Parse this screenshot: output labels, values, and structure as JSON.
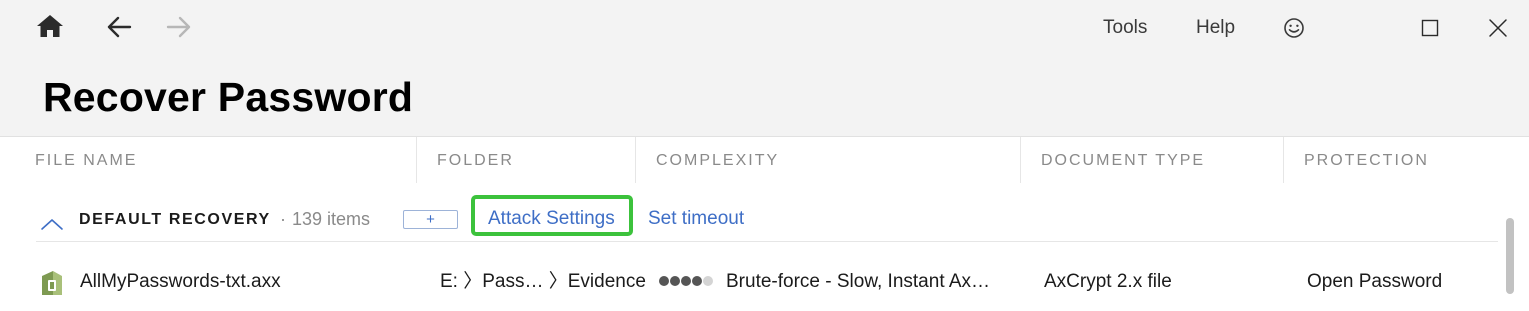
{
  "titlebar": {
    "home_icon": "home-icon",
    "back_icon": "arrow-left-icon",
    "forward_icon": "arrow-right-icon",
    "menu": [
      {
        "label": "Tools"
      },
      {
        "label": "Help"
      }
    ],
    "feedback_icon": "smiley-icon",
    "maximize_icon": "maximize-icon",
    "close_icon": "close-icon"
  },
  "page": {
    "title": "Recover Password"
  },
  "columns": [
    {
      "label": "FILE NAME"
    },
    {
      "label": "FOLDER"
    },
    {
      "label": "COMPLEXITY"
    },
    {
      "label": "DOCUMENT TYPE"
    },
    {
      "label": "PROTECTION"
    }
  ],
  "group": {
    "title": "DEFAULT RECOVERY",
    "separator": "·",
    "count": "139 items",
    "add_label": "+",
    "attack_settings_label": "Attack Settings",
    "set_timeout_label": "Set timeout",
    "expanded": true,
    "highlight_color": "#3cc23c"
  },
  "rows": [
    {
      "file_name": "AllMyPasswords-txt.axx",
      "folder": "E: 〉Pass… 〉Evidence",
      "complexity_level": 4,
      "complexity_max": 5,
      "complexity_text": "Brute-force - Slow, Instant Ax…",
      "document_type": "AxCrypt 2.x file",
      "protection": "Open Password",
      "file_icon": "file-icon"
    }
  ],
  "colors": {
    "accent_link": "#3e6ec6",
    "header_bg": "#f3f3f3",
    "muted_text": "#8a8a8a"
  }
}
